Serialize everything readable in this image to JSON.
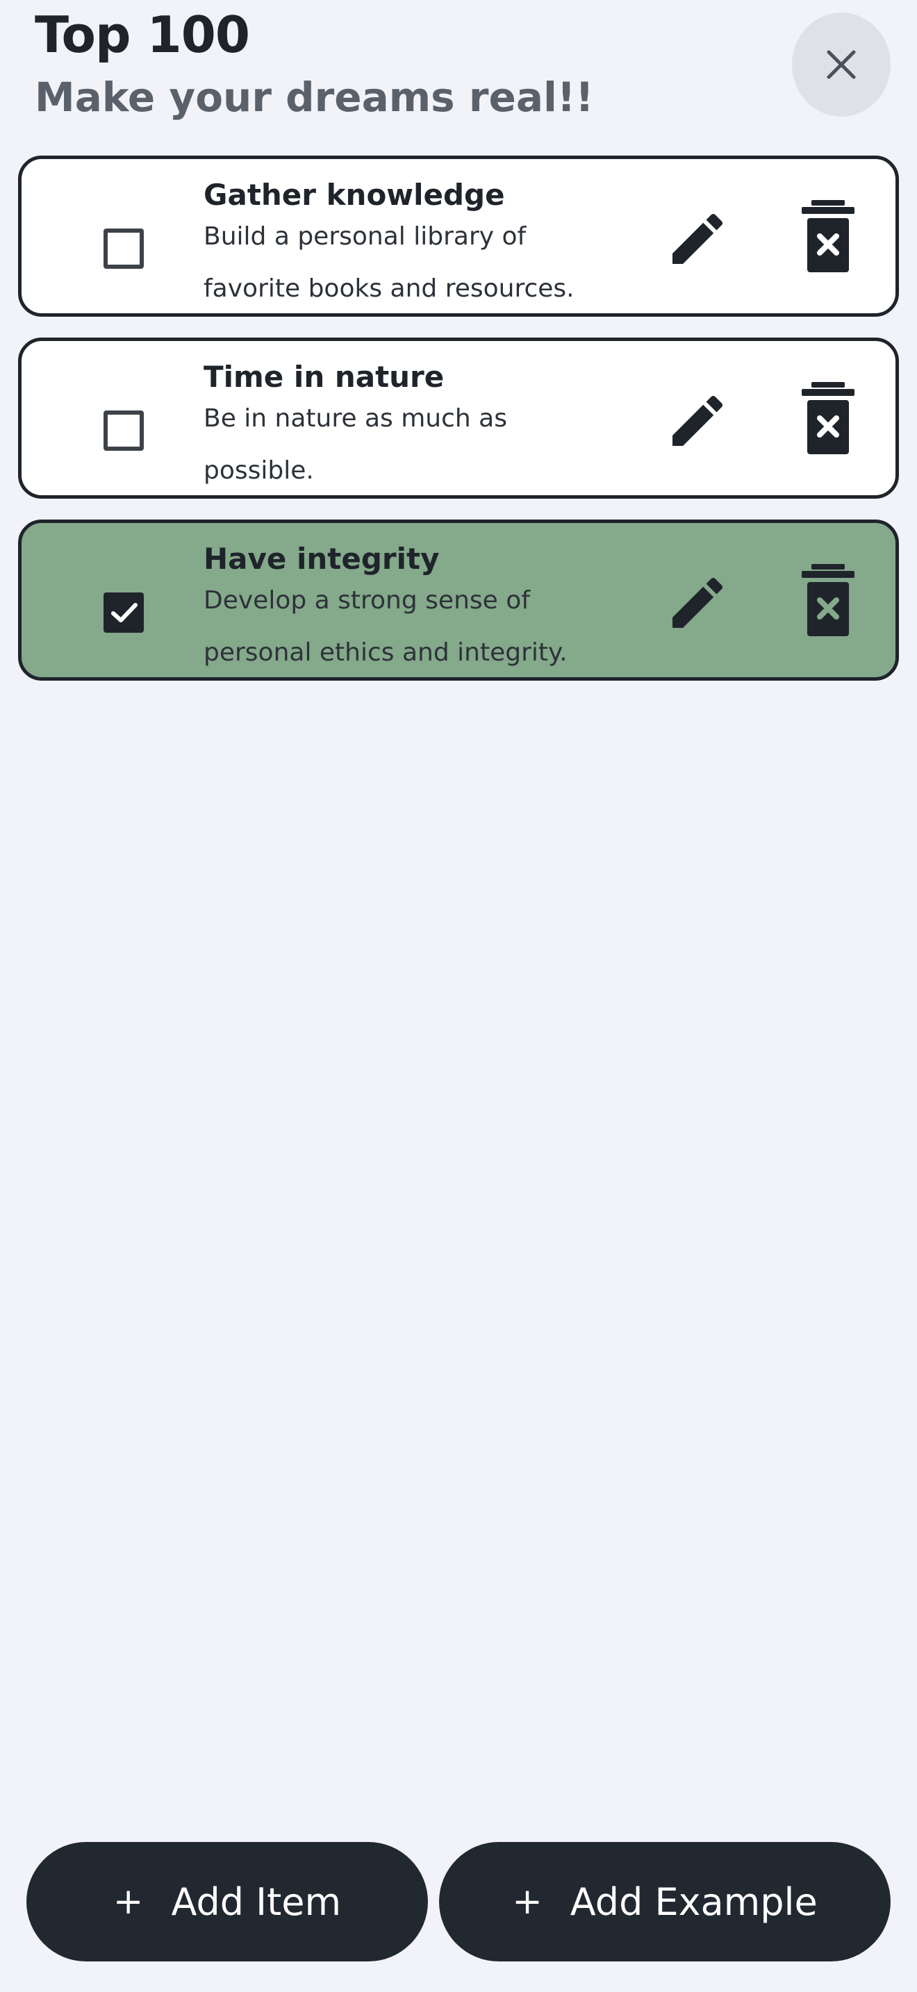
{
  "header": {
    "title": "Top 100",
    "subtitle": "Make your dreams real!!",
    "close_icon": "close-icon"
  },
  "items": [
    {
      "title": "Gather knowledge",
      "description": "Build a personal library of favorite books and resources.",
      "checked": false
    },
    {
      "title": "Time in nature",
      "description": "Be in nature as much as possible.",
      "checked": false
    },
    {
      "title": "Have integrity",
      "description": "Develop a strong sense of personal ethics and integrity.",
      "checked": true
    }
  ],
  "actions": {
    "edit_icon": "pencil-icon",
    "delete_icon": "trash-x-icon"
  },
  "bottom": {
    "add_item_label": "Add Item",
    "add_example_label": "Add Example",
    "plus_glyph": "+"
  },
  "colors": {
    "background": "#f1f3f8",
    "completed_card": "#85a98b",
    "dark": "#1f242b",
    "close_button_bg": "#dfe1e6"
  }
}
